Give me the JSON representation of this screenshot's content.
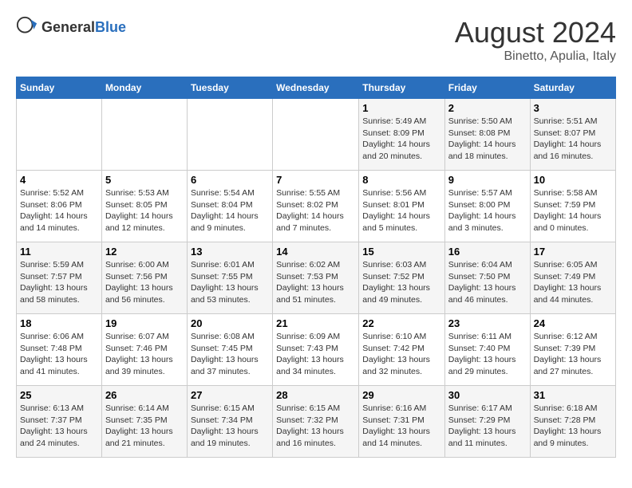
{
  "header": {
    "logo_general": "General",
    "logo_blue": "Blue",
    "month_title": "August 2024",
    "location": "Binetto, Apulia, Italy"
  },
  "weekdays": [
    "Sunday",
    "Monday",
    "Tuesday",
    "Wednesday",
    "Thursday",
    "Friday",
    "Saturday"
  ],
  "weeks": [
    [
      {
        "day": "",
        "info": ""
      },
      {
        "day": "",
        "info": ""
      },
      {
        "day": "",
        "info": ""
      },
      {
        "day": "",
        "info": ""
      },
      {
        "day": "1",
        "info": "Sunrise: 5:49 AM\nSunset: 8:09 PM\nDaylight: 14 hours\nand 20 minutes."
      },
      {
        "day": "2",
        "info": "Sunrise: 5:50 AM\nSunset: 8:08 PM\nDaylight: 14 hours\nand 18 minutes."
      },
      {
        "day": "3",
        "info": "Sunrise: 5:51 AM\nSunset: 8:07 PM\nDaylight: 14 hours\nand 16 minutes."
      }
    ],
    [
      {
        "day": "4",
        "info": "Sunrise: 5:52 AM\nSunset: 8:06 PM\nDaylight: 14 hours\nand 14 minutes."
      },
      {
        "day": "5",
        "info": "Sunrise: 5:53 AM\nSunset: 8:05 PM\nDaylight: 14 hours\nand 12 minutes."
      },
      {
        "day": "6",
        "info": "Sunrise: 5:54 AM\nSunset: 8:04 PM\nDaylight: 14 hours\nand 9 minutes."
      },
      {
        "day": "7",
        "info": "Sunrise: 5:55 AM\nSunset: 8:02 PM\nDaylight: 14 hours\nand 7 minutes."
      },
      {
        "day": "8",
        "info": "Sunrise: 5:56 AM\nSunset: 8:01 PM\nDaylight: 14 hours\nand 5 minutes."
      },
      {
        "day": "9",
        "info": "Sunrise: 5:57 AM\nSunset: 8:00 PM\nDaylight: 14 hours\nand 3 minutes."
      },
      {
        "day": "10",
        "info": "Sunrise: 5:58 AM\nSunset: 7:59 PM\nDaylight: 14 hours\nand 0 minutes."
      }
    ],
    [
      {
        "day": "11",
        "info": "Sunrise: 5:59 AM\nSunset: 7:57 PM\nDaylight: 13 hours\nand 58 minutes."
      },
      {
        "day": "12",
        "info": "Sunrise: 6:00 AM\nSunset: 7:56 PM\nDaylight: 13 hours\nand 56 minutes."
      },
      {
        "day": "13",
        "info": "Sunrise: 6:01 AM\nSunset: 7:55 PM\nDaylight: 13 hours\nand 53 minutes."
      },
      {
        "day": "14",
        "info": "Sunrise: 6:02 AM\nSunset: 7:53 PM\nDaylight: 13 hours\nand 51 minutes."
      },
      {
        "day": "15",
        "info": "Sunrise: 6:03 AM\nSunset: 7:52 PM\nDaylight: 13 hours\nand 49 minutes."
      },
      {
        "day": "16",
        "info": "Sunrise: 6:04 AM\nSunset: 7:50 PM\nDaylight: 13 hours\nand 46 minutes."
      },
      {
        "day": "17",
        "info": "Sunrise: 6:05 AM\nSunset: 7:49 PM\nDaylight: 13 hours\nand 44 minutes."
      }
    ],
    [
      {
        "day": "18",
        "info": "Sunrise: 6:06 AM\nSunset: 7:48 PM\nDaylight: 13 hours\nand 41 minutes."
      },
      {
        "day": "19",
        "info": "Sunrise: 6:07 AM\nSunset: 7:46 PM\nDaylight: 13 hours\nand 39 minutes."
      },
      {
        "day": "20",
        "info": "Sunrise: 6:08 AM\nSunset: 7:45 PM\nDaylight: 13 hours\nand 37 minutes."
      },
      {
        "day": "21",
        "info": "Sunrise: 6:09 AM\nSunset: 7:43 PM\nDaylight: 13 hours\nand 34 minutes."
      },
      {
        "day": "22",
        "info": "Sunrise: 6:10 AM\nSunset: 7:42 PM\nDaylight: 13 hours\nand 32 minutes."
      },
      {
        "day": "23",
        "info": "Sunrise: 6:11 AM\nSunset: 7:40 PM\nDaylight: 13 hours\nand 29 minutes."
      },
      {
        "day": "24",
        "info": "Sunrise: 6:12 AM\nSunset: 7:39 PM\nDaylight: 13 hours\nand 27 minutes."
      }
    ],
    [
      {
        "day": "25",
        "info": "Sunrise: 6:13 AM\nSunset: 7:37 PM\nDaylight: 13 hours\nand 24 minutes."
      },
      {
        "day": "26",
        "info": "Sunrise: 6:14 AM\nSunset: 7:35 PM\nDaylight: 13 hours\nand 21 minutes."
      },
      {
        "day": "27",
        "info": "Sunrise: 6:15 AM\nSunset: 7:34 PM\nDaylight: 13 hours\nand 19 minutes."
      },
      {
        "day": "28",
        "info": "Sunrise: 6:15 AM\nSunset: 7:32 PM\nDaylight: 13 hours\nand 16 minutes."
      },
      {
        "day": "29",
        "info": "Sunrise: 6:16 AM\nSunset: 7:31 PM\nDaylight: 13 hours\nand 14 minutes."
      },
      {
        "day": "30",
        "info": "Sunrise: 6:17 AM\nSunset: 7:29 PM\nDaylight: 13 hours\nand 11 minutes."
      },
      {
        "day": "31",
        "info": "Sunrise: 6:18 AM\nSunset: 7:28 PM\nDaylight: 13 hours\nand 9 minutes."
      }
    ]
  ]
}
